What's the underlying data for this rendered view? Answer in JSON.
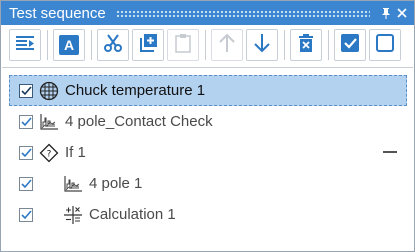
{
  "panel": {
    "title": "Test sequence",
    "title_bar_color": "#3c86d1"
  },
  "toolbar": {
    "buttons": [
      {
        "name": "format-list-icon",
        "enabled": true
      },
      {
        "name": "rename-icon",
        "enabled": true,
        "glyph": "A"
      },
      {
        "name": "cut-icon",
        "enabled": true
      },
      {
        "name": "duplicate-icon",
        "enabled": true
      },
      {
        "name": "paste-icon",
        "enabled": false
      },
      {
        "name": "move-up-icon",
        "enabled": false
      },
      {
        "name": "move-down-icon",
        "enabled": true
      },
      {
        "name": "delete-icon",
        "enabled": true
      },
      {
        "name": "check-all-icon",
        "enabled": true
      },
      {
        "name": "uncheck-all-icon",
        "enabled": true
      }
    ]
  },
  "tree": {
    "items": [
      {
        "label": "Chuck temperature 1",
        "checked": true,
        "selected": true,
        "icon": "globe-grid-icon",
        "level": 0
      },
      {
        "label": "4 pole_Contact Check",
        "checked": true,
        "selected": false,
        "icon": "chart-step-icon",
        "level": 0
      },
      {
        "label": "If 1",
        "checked": true,
        "selected": false,
        "icon": "condition-diamond-icon",
        "level": 0,
        "collapsible": true
      },
      {
        "label": "4 pole 1",
        "checked": true,
        "selected": false,
        "icon": "chart-step-icon",
        "level": 1
      },
      {
        "label": "Calculation 1",
        "checked": true,
        "selected": false,
        "icon": "calculator-icon",
        "level": 1
      }
    ]
  }
}
